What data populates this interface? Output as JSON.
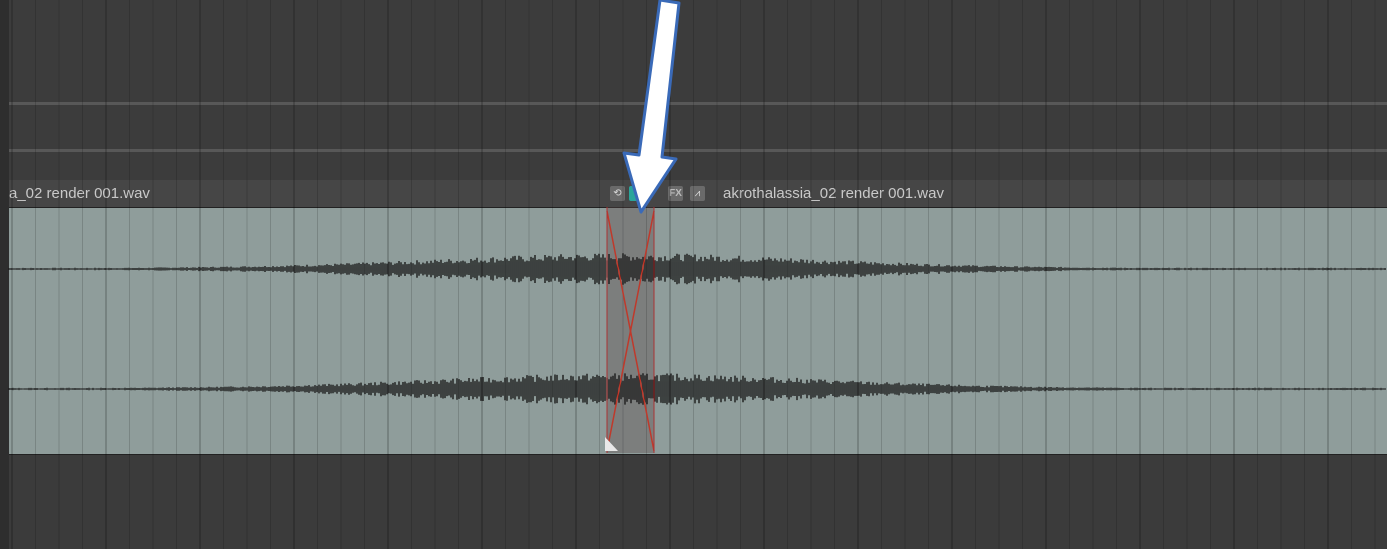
{
  "clips": {
    "left_clip_name": "a_02 render 001.wav",
    "right_clip_name": "akrothalassia_02 render 001.wav"
  },
  "clip_icons": [
    {
      "name": "loop-icon",
      "glyph": "⟲"
    },
    {
      "name": "take-icon",
      "glyph": "■"
    },
    {
      "name": "fx-icon",
      "glyph": "FX"
    },
    {
      "name": "envelope-icon",
      "glyph": "⩘"
    }
  ],
  "colors": {
    "clip_body": "#8f9d9b",
    "waveform": "#1a1a1a",
    "crossfade_lines": "#c0392b",
    "arrow_fill": "#ffffff",
    "arrow_stroke": "#3a6ab8",
    "callout_bar": "#1a2a9e"
  }
}
